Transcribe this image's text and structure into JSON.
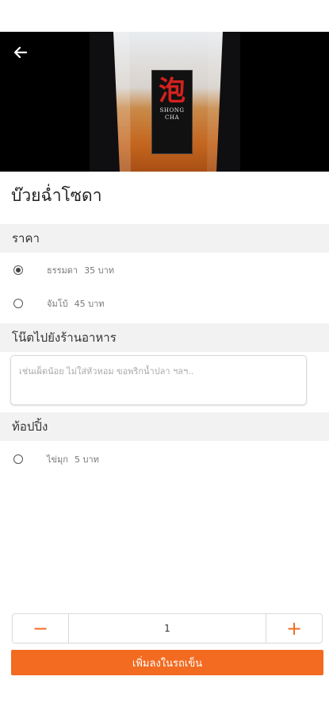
{
  "product": {
    "title": "บ๊วยฉ่ำโซดา",
    "logo": {
      "char": "泡",
      "line1": "SHONG",
      "line2": "CHA"
    }
  },
  "price_section": {
    "label": "ราคา",
    "options": [
      {
        "name": "ธรรมดา",
        "price": "35 บาท",
        "selected": true
      },
      {
        "name": "จัมโบ้",
        "price": "45 บาท",
        "selected": false
      }
    ]
  },
  "note_section": {
    "label": "โน๊ตไปยังร้านอาหาร",
    "placeholder": "เช่นเผ็ดน้อย ไม่ใส่หัวหอม ขอพริกน้ำปลา ฯลฯ..",
    "value": ""
  },
  "topping_section": {
    "label": "ท้อปปิ้ง",
    "options": [
      {
        "name": "ไข่มุก",
        "price": "5 บาท",
        "selected": false
      }
    ]
  },
  "quantity": {
    "minus": "−",
    "value": "1",
    "plus": "+"
  },
  "add_to_cart": {
    "label": "เพิ่มลงในรถเข็น"
  },
  "colors": {
    "accent": "#f26b21",
    "section_bg": "#f2f2f2"
  },
  "icons": {
    "back": "arrow-left-icon"
  }
}
